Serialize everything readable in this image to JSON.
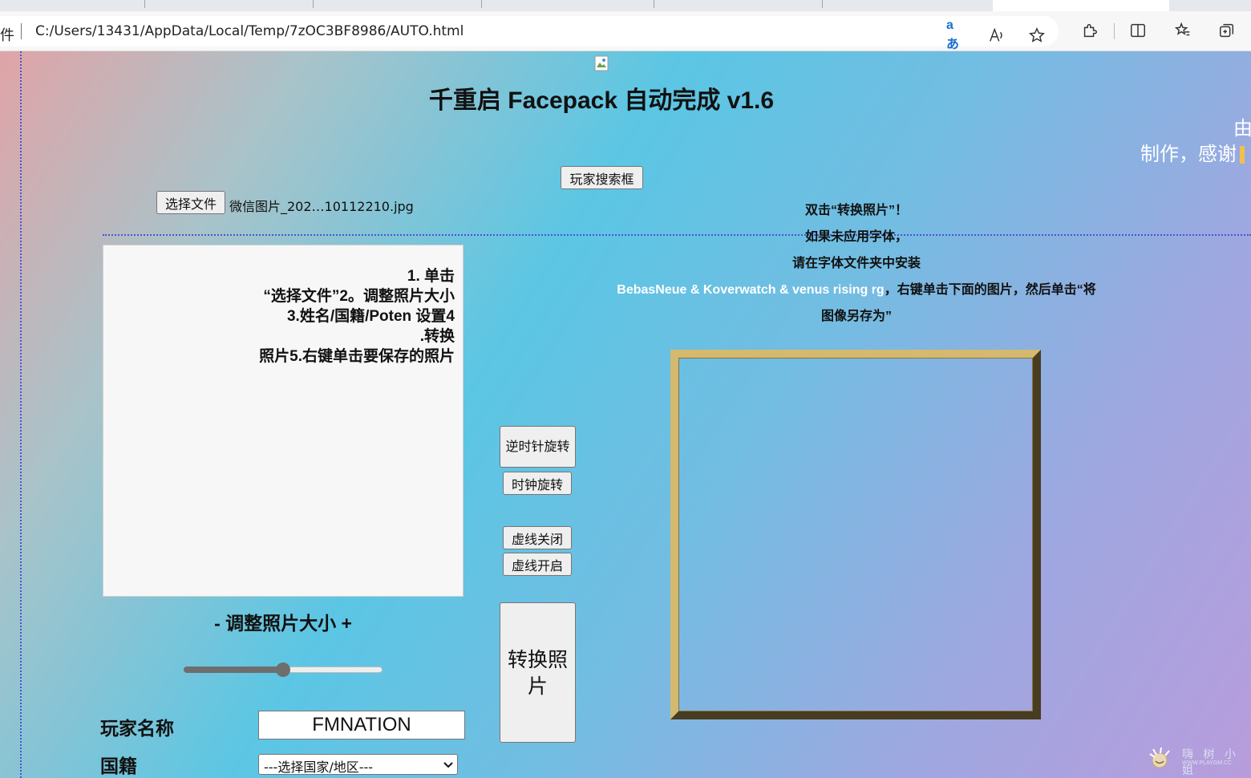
{
  "browser": {
    "url_prefix": "件",
    "url": "C:/Users/13431/AppData/Local/Temp/7zOC3BF8986/AUTO.html",
    "toolbar_icons": [
      "translate-icon",
      "read-aloud-icon",
      "favorite-star-icon",
      "extensions-icon",
      "split-screen-icon",
      "favorites-icon",
      "collections-icon"
    ]
  },
  "page": {
    "title": "千重启 Facepack 自动完成 v1.6",
    "credit_line1": "由",
    "credit_line2": "制作，感谢",
    "player_search_button": "玩家搜索框",
    "choose_file_button": "选择文件",
    "chosen_file_name": "微信图片_202…10112210.jpg",
    "instructions": {
      "line1": "双击“转换照片”！",
      "line2": "如果未应用字体，",
      "line3": "请在字体文件夹中安装",
      "line4_fonts": "BebasNeue & Koverwatch & venus rising rg",
      "line4_rest": "，右键单击下面的图片，然后单击“将",
      "line5": "图像另存为”"
    },
    "steps": {
      "line1": "1. 单击",
      "line2": "“选择文件”2。调整照片大小",
      "line3": "3.姓名/国籍/Poten 设置4",
      "line4": ".转换",
      "line5": "照片5.右键单击要保存的照片"
    },
    "rotate_ccw_button": "逆时针旋转",
    "rotate_cw_button": "时钟旋转",
    "guides_off_button": "虚线关闭",
    "guides_on_button": "虚线开启",
    "convert_button": "转换照片",
    "resize_label": "- 调整照片大小 +",
    "resize_slider_value": 0.5,
    "player_name_label": "玩家名称",
    "player_name_value": "FMNATION",
    "nationality_label": "国籍",
    "nationality_selected": "---选择国家/地区---",
    "watermark_text": "嗨 树 小 姐",
    "watermark_url": "WWW.PLAYGM.CC"
  },
  "colors": {
    "frame_gold": "#c8ad6a",
    "guide_line": "#4b54d6",
    "gradient": [
      "#e0a4a7",
      "#5bc6e4",
      "#b89cdc"
    ]
  }
}
